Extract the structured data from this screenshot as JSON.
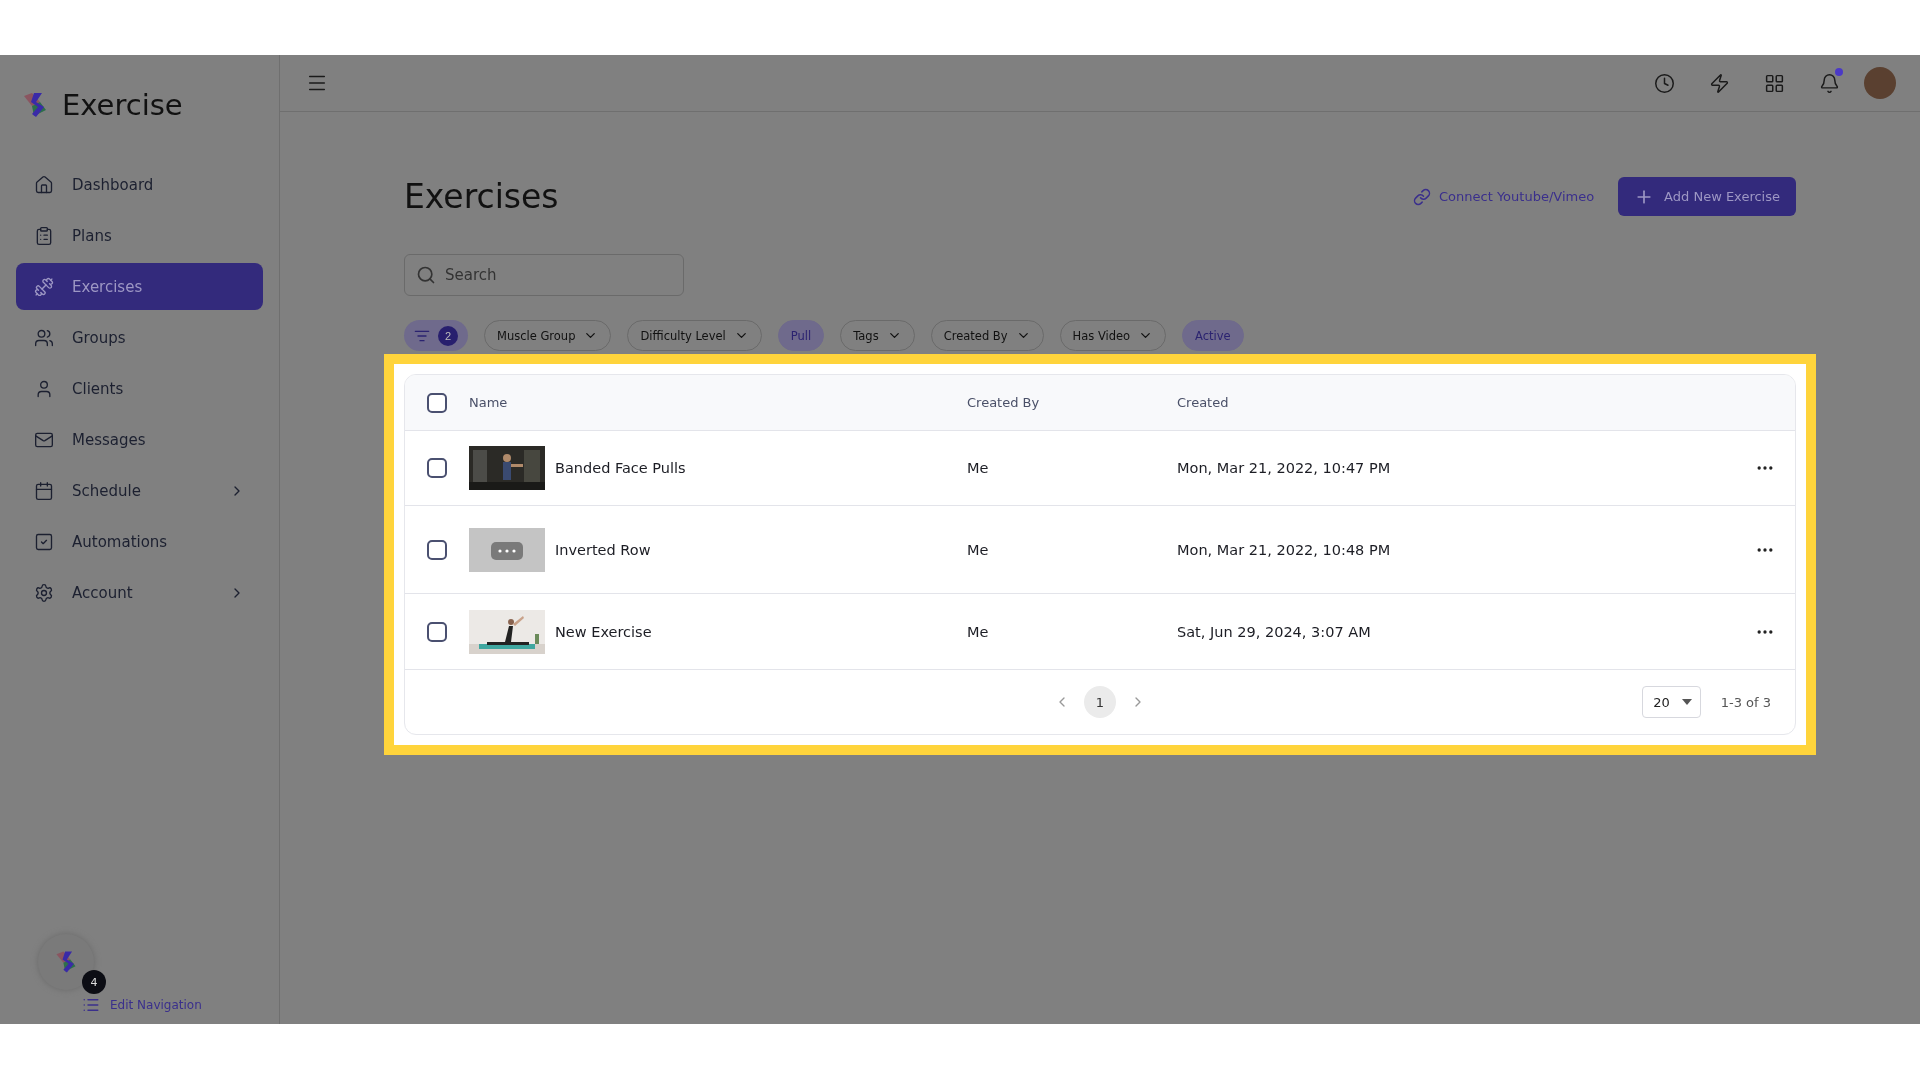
{
  "sidebar": {
    "brand": "Exercise",
    "items": [
      {
        "label": "Dashboard",
        "selected": false,
        "submenu": false
      },
      {
        "label": "Plans",
        "selected": false,
        "submenu": false
      },
      {
        "label": "Exercises",
        "selected": true,
        "submenu": false
      },
      {
        "label": "Groups",
        "selected": false,
        "submenu": false
      },
      {
        "label": "Clients",
        "selected": false,
        "submenu": false
      },
      {
        "label": "Messages",
        "selected": false,
        "submenu": false
      },
      {
        "label": "Schedule",
        "selected": false,
        "submenu": true
      },
      {
        "label": "Automations",
        "selected": false,
        "submenu": false
      },
      {
        "label": "Account",
        "selected": false,
        "submenu": true
      }
    ],
    "helper_badge": "4",
    "edit_navigation": "Edit Navigation"
  },
  "topbar": {
    "notifications_unread": true
  },
  "page": {
    "title": "Exercises",
    "connect_link": "Connect Youtube/Vimeo",
    "add_button": "Add New Exercise",
    "search": {
      "placeholder": "Search"
    },
    "filter_count": "2",
    "filters": [
      {
        "label": "Muscle Group",
        "kind": "dropdown",
        "selected": false
      },
      {
        "label": "Difficulty Level",
        "kind": "dropdown",
        "selected": false
      },
      {
        "label": "Pull",
        "kind": "chip",
        "selected": true
      },
      {
        "label": "Tags",
        "kind": "dropdown",
        "selected": false
      },
      {
        "label": "Created By",
        "kind": "dropdown",
        "selected": false
      },
      {
        "label": "Has Video",
        "kind": "dropdown",
        "selected": false
      },
      {
        "label": "Active",
        "kind": "chip",
        "selected": true
      }
    ]
  },
  "table": {
    "columns": [
      "Name",
      "Created By",
      "Created"
    ],
    "all_checked": false,
    "rows": [
      {
        "name": "Banded Face Pulls",
        "created_by": "Me",
        "created": "Mon, Mar 21, 2022, 10:47 PM",
        "checked": false
      },
      {
        "name": "Inverted Row",
        "created_by": "Me",
        "created": "Mon, Mar 21, 2022, 10:48 PM",
        "checked": false
      },
      {
        "name": "New Exercise",
        "created_by": "Me",
        "created": "Sat, Jun 29, 2024, 3:07 AM",
        "checked": false
      }
    ],
    "pages": [
      {
        "label": "1",
        "selected": true
      }
    ],
    "page_size": "20",
    "range": "1-3 of 3"
  }
}
